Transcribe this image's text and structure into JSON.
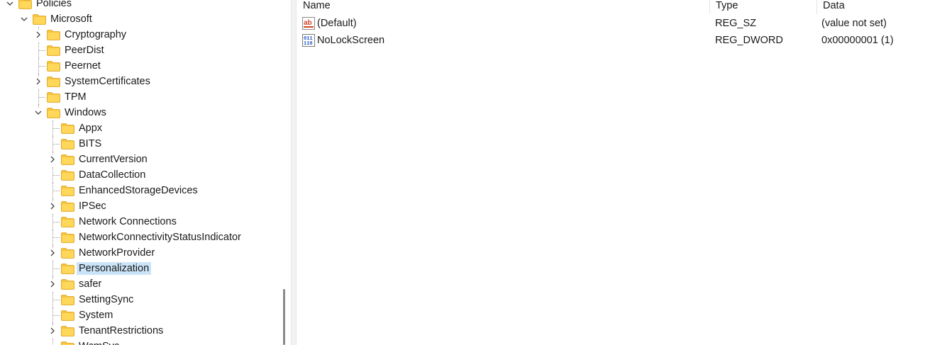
{
  "tree": {
    "items": [
      {
        "label": "Policies",
        "icon": "folder-icon"
      },
      {
        "label": "Microsoft",
        "icon": "folder-icon"
      },
      {
        "label": "Cryptography",
        "icon": "folder-icon"
      },
      {
        "label": "PeerDist",
        "icon": "folder-icon"
      },
      {
        "label": "Peernet",
        "icon": "folder-icon"
      },
      {
        "label": "SystemCertificates",
        "icon": "folder-icon"
      },
      {
        "label": "TPM",
        "icon": "folder-icon"
      },
      {
        "label": "Windows",
        "icon": "folder-icon"
      },
      {
        "label": "Appx",
        "icon": "folder-icon"
      },
      {
        "label": "BITS",
        "icon": "folder-icon"
      },
      {
        "label": "CurrentVersion",
        "icon": "folder-icon"
      },
      {
        "label": "DataCollection",
        "icon": "folder-icon"
      },
      {
        "label": "EnhancedStorageDevices",
        "icon": "folder-icon"
      },
      {
        "label": "IPSec",
        "icon": "folder-icon"
      },
      {
        "label": "Network Connections",
        "icon": "folder-icon"
      },
      {
        "label": "NetworkConnectivityStatusIndicator",
        "icon": "folder-icon"
      },
      {
        "label": "NetworkProvider",
        "icon": "folder-icon"
      },
      {
        "label": "Personalization",
        "icon": "folder-icon",
        "selected": true
      },
      {
        "label": "safer",
        "icon": "folder-icon"
      },
      {
        "label": "SettingSync",
        "icon": "folder-icon"
      },
      {
        "label": "System",
        "icon": "folder-icon"
      },
      {
        "label": "TenantRestrictions",
        "icon": "folder-icon"
      },
      {
        "label": "WcmSvc",
        "icon": "folder-icon"
      }
    ],
    "selection_color": "#cce4f7",
    "folder_color": "#f8c33c"
  },
  "values": {
    "columns": {
      "name": "Name",
      "type": "Type",
      "data": "Data"
    },
    "rows": [
      {
        "name": "(Default)",
        "type": "REG_SZ",
        "data": "(value not set)",
        "icon": "string-value-icon"
      },
      {
        "name": "NoLockScreen",
        "type": "REG_DWORD",
        "data": "0x00000001 (1)",
        "icon": "binary-value-icon"
      }
    ]
  }
}
